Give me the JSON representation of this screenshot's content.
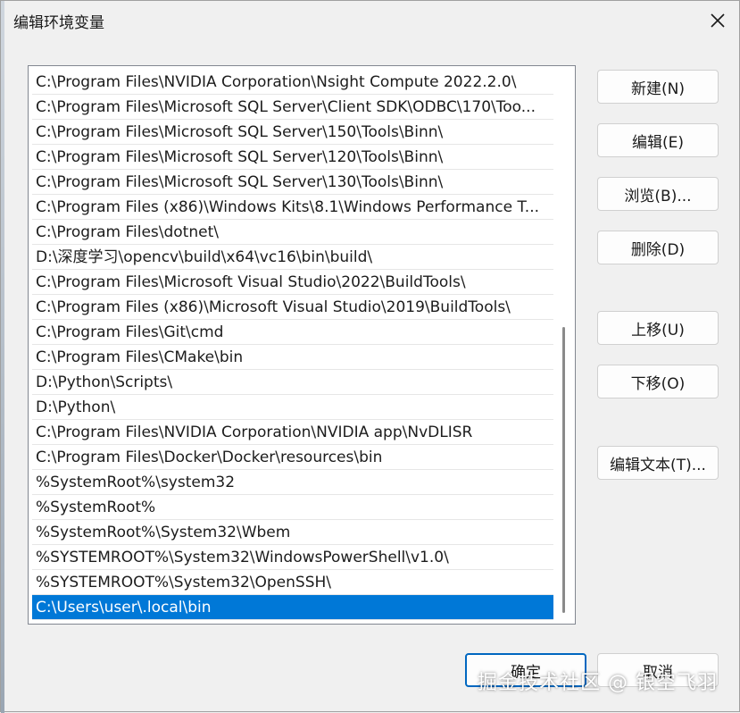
{
  "dialog": {
    "title": "编辑环境变量",
    "close_icon": "close-icon"
  },
  "list": {
    "items": [
      "C:\\Program Files\\NVIDIA Corporation\\Nsight Compute 2022.2.0\\",
      "C:\\Program Files\\Microsoft SQL Server\\Client SDK\\ODBC\\170\\Too...",
      "C:\\Program Files\\Microsoft SQL Server\\150\\Tools\\Binn\\",
      "C:\\Program Files\\Microsoft SQL Server\\120\\Tools\\Binn\\",
      "C:\\Program Files\\Microsoft SQL Server\\130\\Tools\\Binn\\",
      "C:\\Program Files (x86)\\Windows Kits\\8.1\\Windows Performance T...",
      "C:\\Program Files\\dotnet\\",
      "D:\\深度学习\\opencv\\build\\x64\\vc16\\bin\\build\\",
      "C:\\Program Files\\Microsoft Visual Studio\\2022\\BuildTools\\",
      "C:\\Program Files (x86)\\Microsoft Visual Studio\\2019\\BuildTools\\",
      "C:\\Program Files\\Git\\cmd",
      "C:\\Program Files\\CMake\\bin",
      "D:\\Python\\Scripts\\",
      "D:\\Python\\",
      "C:\\Program Files\\NVIDIA Corporation\\NVIDIA app\\NvDLISR",
      "C:\\Program Files\\Docker\\Docker\\resources\\bin",
      "%SystemRoot%\\system32",
      "%SystemRoot%",
      "%SystemRoot%\\System32\\Wbem",
      "%SYSTEMROOT%\\System32\\WindowsPowerShell\\v1.0\\",
      "%SYSTEMROOT%\\System32\\OpenSSH\\",
      "C:\\Users\\user\\.local\\bin"
    ],
    "selected_index": 21
  },
  "buttons": {
    "new": "新建(N)",
    "edit": "编辑(E)",
    "browse": "浏览(B)...",
    "delete": "删除(D)",
    "move_up": "上移(U)",
    "move_down": "下移(O)",
    "edit_text": "编辑文本(T)...",
    "ok": "确定",
    "cancel": "取消"
  },
  "watermark": "掘金技术社区 @ 银空飞羽",
  "colors": {
    "selection": "#0078d7",
    "primary_border": "#0067c0"
  }
}
